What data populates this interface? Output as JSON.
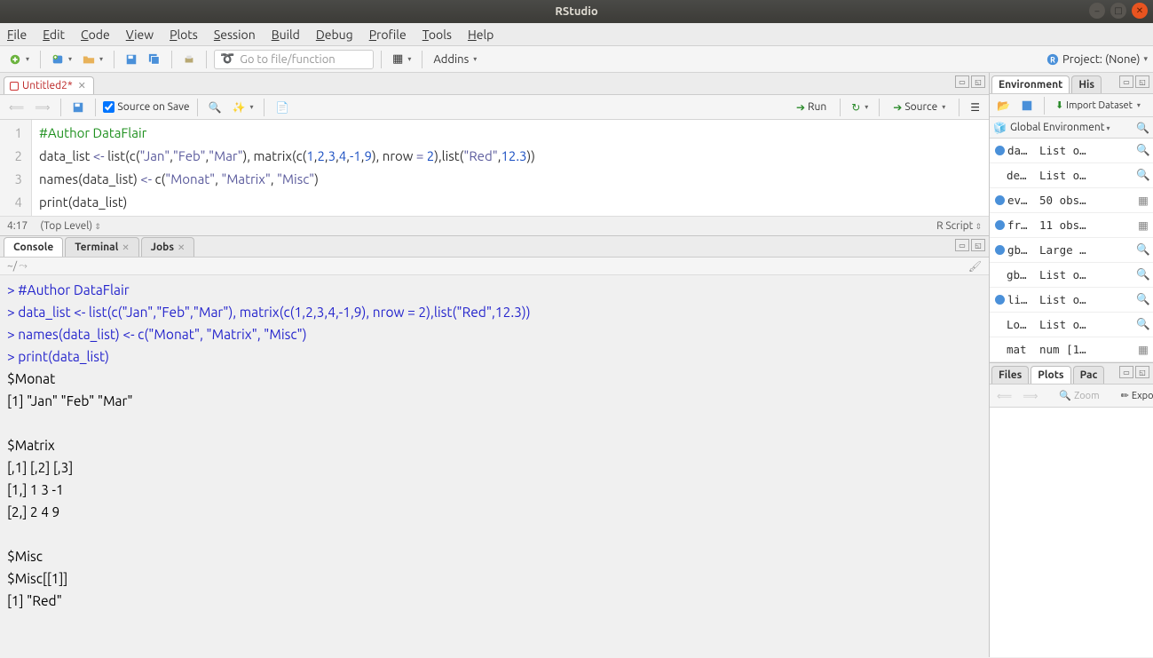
{
  "window": {
    "title": "RStudio"
  },
  "menus": [
    "File",
    "Edit",
    "Code",
    "View",
    "Plots",
    "Session",
    "Build",
    "Debug",
    "Profile",
    "Tools",
    "Help"
  ],
  "toolbar": {
    "goto_placeholder": "Go to file/function",
    "addins": "Addins",
    "project_label": "Project: (None)"
  },
  "source": {
    "tab_name": "Untitled2*",
    "sos_label": "Source on Save",
    "run_label": "Run",
    "source_label": "Source",
    "cursor": "4:17",
    "scope": "(Top Level)",
    "filetype": "R Script",
    "lines": [
      {
        "n": "1",
        "html": "<span class='c-comment'>#Author DataFlair</span>"
      },
      {
        "n": "2",
        "html": "data_list <span class='c-op'>&lt;-</span> list(c(<span class='c-str'>\"Jan\"</span>,<span class='c-str'>\"Feb\"</span>,<span class='c-str'>\"Mar\"</span>), matrix(c(<span class='c-num'>1</span>,<span class='c-num'>2</span>,<span class='c-num'>3</span>,<span class='c-num'>4</span>,<span class='c-num'>-1</span>,<span class='c-num'>9</span>), nrow <span class='c-op'>=</span> <span class='c-num'>2</span>),list(<span class='c-str'>\"Red\"</span>,<span class='c-num'>12.3</span>))"
      },
      {
        "n": "3",
        "html": "names(data_list) <span class='c-op'>&lt;-</span> c(<span class='c-str'>\"Monat\"</span>, <span class='c-str'>\"Matrix\"</span>, <span class='c-str'>\"Misc\"</span>)"
      },
      {
        "n": "4",
        "html": "print(data_list)"
      }
    ]
  },
  "console": {
    "tabs": [
      "Console",
      "Terminal",
      "Jobs"
    ],
    "wd": "~/",
    "lines": [
      {
        "cls": "p",
        "t": "> #Author DataFlair"
      },
      {
        "cls": "p",
        "t": "> data_list <- list(c(\"Jan\",\"Feb\",\"Mar\"), matrix(c(1,2,3,4,-1,9), nrow = 2),list(\"Red\",12.3))"
      },
      {
        "cls": "p",
        "t": "> names(data_list) <- c(\"Monat\", \"Matrix\", \"Misc\")"
      },
      {
        "cls": "p",
        "t": "> print(data_list)"
      },
      {
        "cls": "out",
        "t": "$Monat"
      },
      {
        "cls": "out",
        "t": "[1] \"Jan\" \"Feb\" \"Mar\""
      },
      {
        "cls": "out",
        "t": ""
      },
      {
        "cls": "out",
        "t": "$Matrix"
      },
      {
        "cls": "out",
        "t": "     [,1] [,2] [,3]"
      },
      {
        "cls": "out",
        "t": "[1,]    1    3   -1"
      },
      {
        "cls": "out",
        "t": "[2,]    2    4    9"
      },
      {
        "cls": "out",
        "t": ""
      },
      {
        "cls": "out",
        "t": "$Misc"
      },
      {
        "cls": "out",
        "t": "$Misc[[1]]"
      },
      {
        "cls": "out",
        "t": "[1] \"Red\""
      }
    ]
  },
  "env": {
    "tabs": [
      "Environment",
      "His"
    ],
    "import_label": "Import Dataset",
    "scope": "Global Environment",
    "rows": [
      {
        "dot": true,
        "name": "da…",
        "val": "List o…",
        "ic": "🔍"
      },
      {
        "dot": false,
        "name": "de…",
        "val": "List o…",
        "ic": "🔍"
      },
      {
        "dot": true,
        "name": "ev…",
        "val": "50 obs…",
        "ic": "▦"
      },
      {
        "dot": true,
        "name": "fr…",
        "val": "11 obs…",
        "ic": "▦"
      },
      {
        "dot": true,
        "name": "gb…",
        "val": "Large …",
        "ic": "🔍"
      },
      {
        "dot": false,
        "name": "gb…",
        "val": "List o…",
        "ic": "🔍"
      },
      {
        "dot": true,
        "name": "li…",
        "val": "List o…",
        "ic": "🔍"
      },
      {
        "dot": false,
        "name": "Lo…",
        "val": "List o…",
        "ic": "🔍"
      },
      {
        "dot": false,
        "name": "mat",
        "val": "num [1…",
        "ic": "▦"
      }
    ]
  },
  "plots": {
    "tabs": [
      "Files",
      "Plots",
      "Pac"
    ],
    "zoom": "Zoom",
    "export": "Expo"
  }
}
